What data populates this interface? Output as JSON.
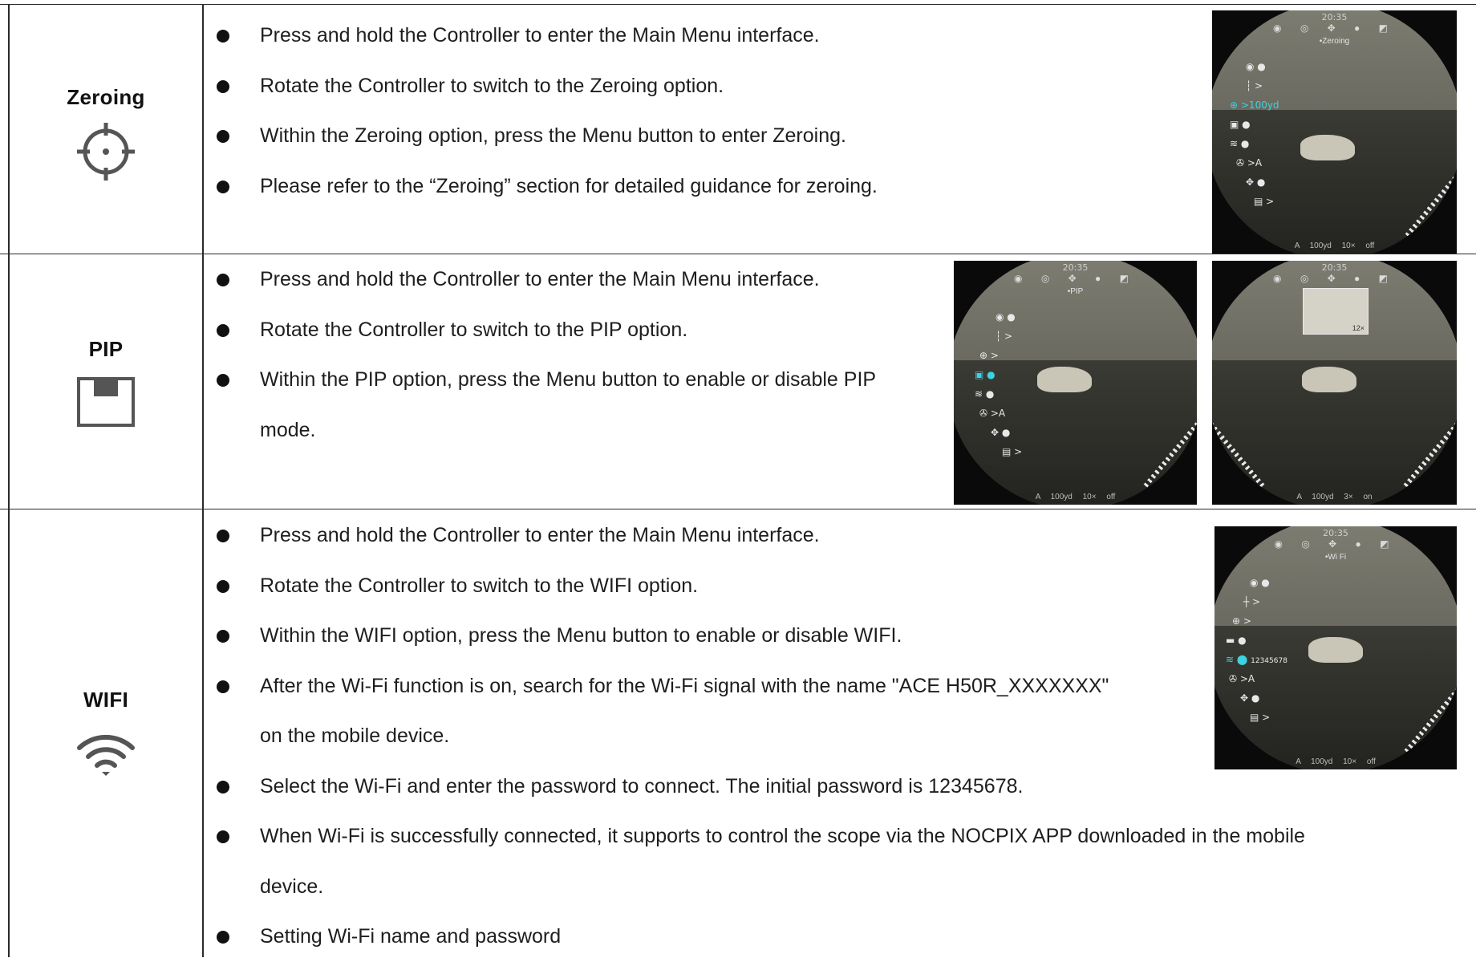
{
  "rows": [
    {
      "name": "Zeroing",
      "icon": "crosshair-icon",
      "bullets": [
        "Press and hold the Controller to enter the Main Menu interface.",
        "Rotate the Controller to switch to the Zeroing option.",
        "Within the Zeroing option, press the Menu button to enter Zeroing.",
        "Please refer to the “Zeroing” section for detailed guidance for zeroing."
      ],
      "screen": {
        "time": "20:35",
        "title": "•Zeroing",
        "menu": [
          ">",
          ">100yd",
          ">A",
          ">"
        ],
        "footer": "A 100yd  10×  off"
      }
    },
    {
      "name": "PIP",
      "icon": "pip-icon",
      "bullets": [
        "Press and hold the Controller to enter the Main Menu interface.",
        "Rotate the Controller to switch to the PIP option."
      ],
      "bullet3_line1": "Within the PIP option, press the Menu button to enable or disable PIP",
      "bullet3_line2": "mode.",
      "screen1": {
        "time": "20:35",
        "title": "•PIP",
        "menu": [
          ">",
          ">",
          ">A",
          ">"
        ],
        "footer": "A 100yd  10×  off"
      },
      "screen2": {
        "time": "20:35",
        "inset_zoom": "12×",
        "footer": "A 100yd  3×  on"
      }
    },
    {
      "name": "WIFI",
      "icon": "wifi-icon",
      "bullets": [
        "Press and hold the Controller to enter the Main Menu interface.",
        "Rotate the Controller to switch to the WIFI option.",
        "Within the WIFI option, press the Menu button to enable or disable WIFI."
      ],
      "bullet4_line1": "After the Wi-Fi function is on, search for the Wi-Fi signal with the name \"ACE H50R_XXXXXXX\"",
      "bullet4_line2": "on the mobile device.",
      "bullet5": "Select the Wi-Fi and enter the password to connect. The initial password is 12345678.",
      "bullet6_line1": "When Wi-Fi is successfully connected, it supports to control the scope via the NOCPIX APP downloaded in the mobile",
      "bullet6_line2": "device.",
      "bullet7": "Setting Wi-Fi name and password",
      "screen": {
        "time": "20:35",
        "title": "•Wi Fi",
        "menu": [
          ">",
          ">",
          "12345678",
          ">A",
          ">"
        ],
        "footer": "A 100yd  10×  off"
      }
    }
  ]
}
